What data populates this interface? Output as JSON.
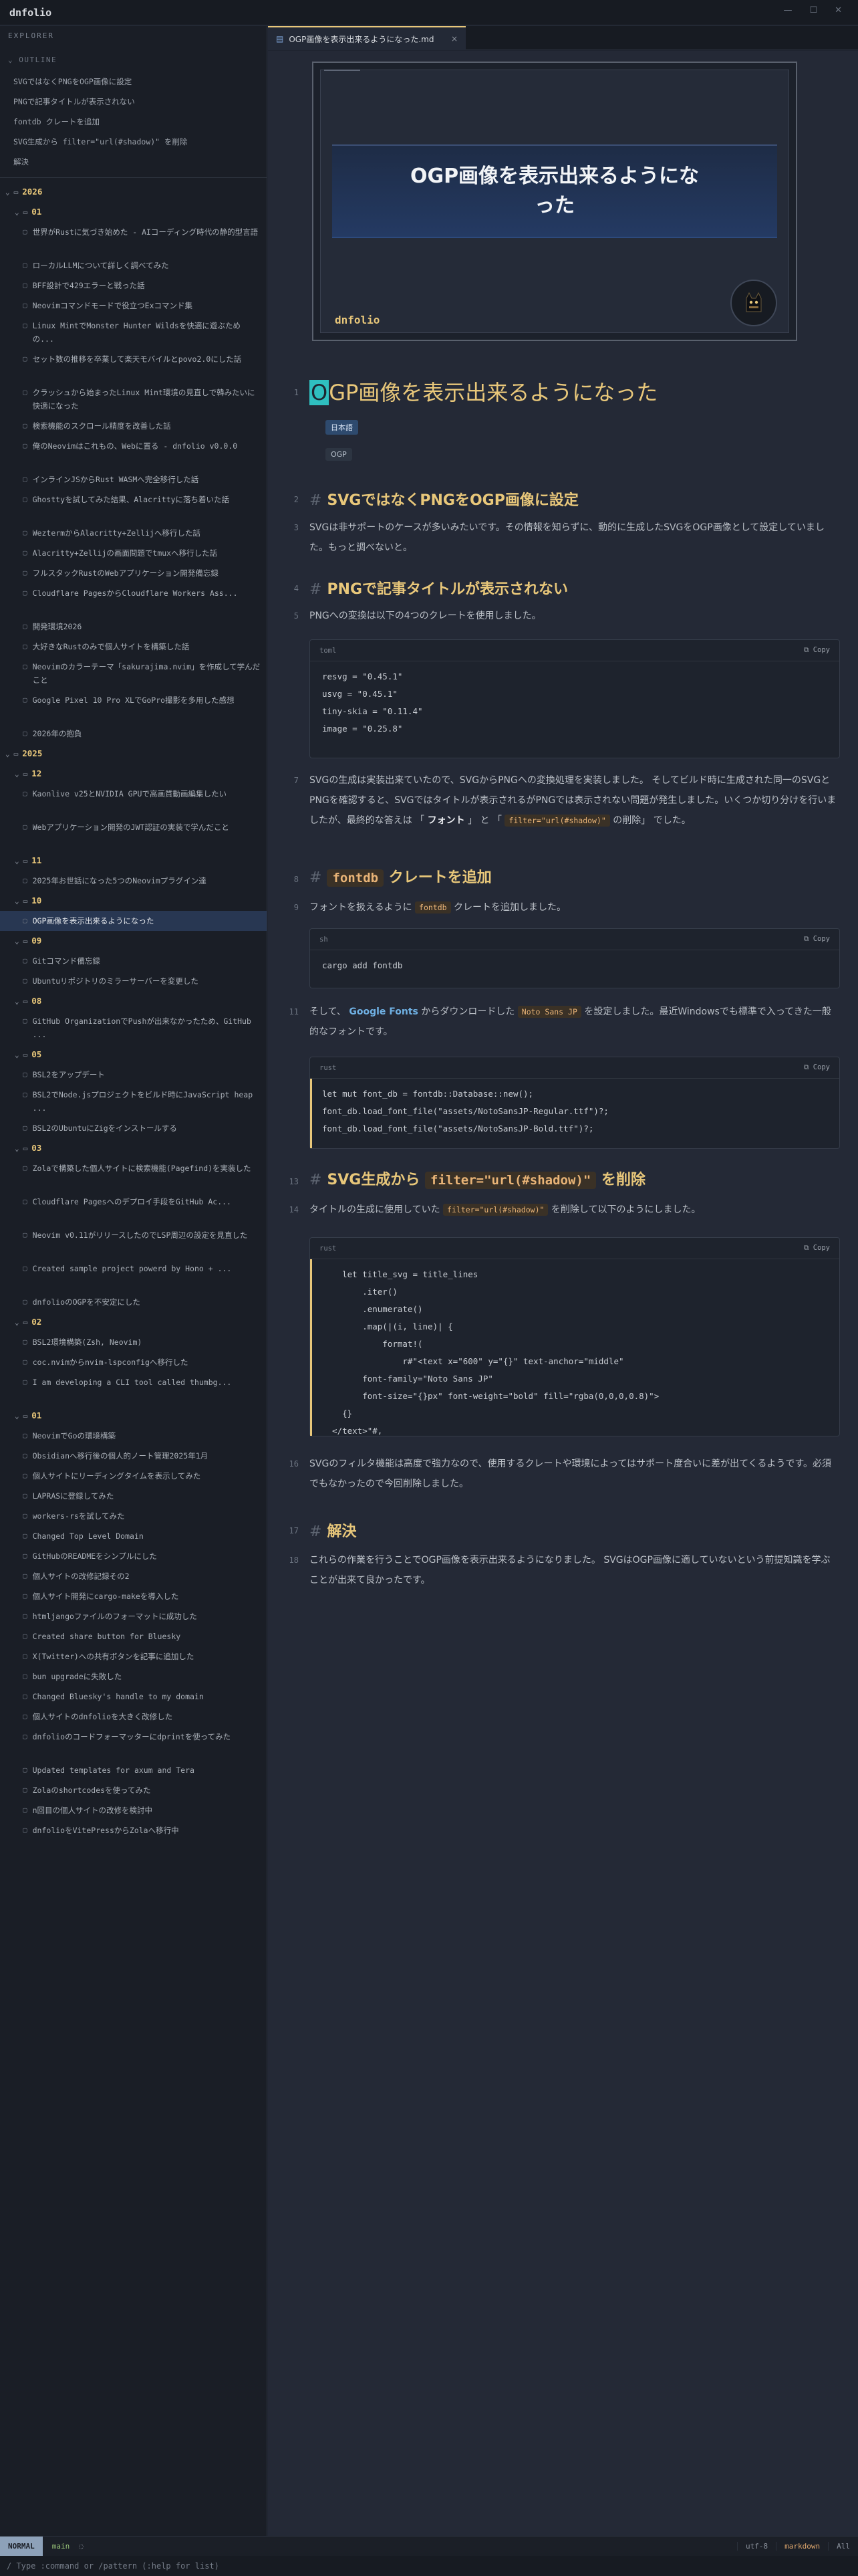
{
  "app": {
    "title": "dnfolio",
    "min": "—",
    "max": "☐",
    "close": "✕"
  },
  "sidebar": {
    "header": "EXPLORER",
    "outline_label": "⌄ OUTLINE",
    "outline": [
      "SVGではなくPNGをOGP画像に設定",
      "PNGで記事タイトルが表示されない",
      "fontdb クレートを追加",
      "SVG生成から filter=\"url(#shadow)\" を削除",
      "解決"
    ],
    "tree": [
      {
        "kind": "year",
        "label": "2026"
      },
      {
        "kind": "month",
        "label": "01"
      },
      {
        "kind": "file",
        "label": "世界がRustに気づき始めた - AIコーディング時代の静的型言語",
        "two": true
      },
      {
        "kind": "file",
        "label": "ローカルLLMについて詳しく調べてみた"
      },
      {
        "kind": "file",
        "label": "BFF設計で429エラーと戦った話"
      },
      {
        "kind": "file",
        "label": "Neovimコマンドモードで役立つExコマンド集"
      },
      {
        "kind": "file",
        "label": "Linux MintでMonster Hunter Wildsを快適に遊ぶための...",
        "two": true
      },
      {
        "kind": "file",
        "label": "セット数の推移を卒業して楽天モバイルとpovo2.0にした話",
        "two": true
      },
      {
        "kind": "file",
        "label": "クラッシュから始まったLinux Mint環境の見直しで韓みたいに快適になった",
        "two": true
      },
      {
        "kind": "file",
        "label": "検索機能のスクロール精度を改善した話"
      },
      {
        "kind": "file",
        "label": "俺のNeovimはこれもの、Webに置る - dnfolio v0.0.0",
        "two": true
      },
      {
        "kind": "file",
        "label": "インラインJSからRust WASMへ完全移行した話"
      },
      {
        "kind": "file",
        "label": "Ghosttyを試してみた結果、Alacrittyに落ち着いた話",
        "two": true
      },
      {
        "kind": "file",
        "label": "WeztermからAlacritty+Zellijへ移行した話"
      },
      {
        "kind": "file",
        "label": "Alacritty+Zellijの画面問題でtmuxへ移行した話"
      },
      {
        "kind": "file",
        "label": "フルスタックRustのWebアプリケーション開発備忘録"
      },
      {
        "kind": "file",
        "label": "Cloudflare PagesからCloudflare Workers Ass...",
        "two": true
      },
      {
        "kind": "file",
        "label": "開発環境2026"
      },
      {
        "kind": "file",
        "label": "大好きなRustのみで個人サイトを構築した話"
      },
      {
        "kind": "file",
        "label": "Neovimのカラーテーマ「sakurajima.nvim」を作成して学んだこと",
        "two": true
      },
      {
        "kind": "file",
        "label": "Google Pixel 10 Pro XLでGoPro撮影を多用した感想",
        "two": true
      },
      {
        "kind": "file",
        "label": "2026年の抱負"
      },
      {
        "kind": "year",
        "label": "2025"
      },
      {
        "kind": "month",
        "label": "12"
      },
      {
        "kind": "file",
        "label": "Kaonlive v25とNVIDIA GPUで高画質動画編集したい",
        "two": true
      },
      {
        "kind": "file",
        "label": "Webアプリケーション開発のJWT認証の実装で学んだこと",
        "two": true
      },
      {
        "kind": "month",
        "label": "11"
      },
      {
        "kind": "file",
        "label": "2025年お世話になった5つのNeovimプラグイン達"
      },
      {
        "kind": "month",
        "label": "10"
      },
      {
        "kind": "file",
        "label": "OGP画像を表示出来るようになった",
        "active": true
      },
      {
        "kind": "month",
        "label": "09"
      },
      {
        "kind": "file",
        "label": "Gitコマンド備忘録"
      },
      {
        "kind": "file",
        "label": "Ubuntuリポジトリのミラーサーバーを変更した"
      },
      {
        "kind": "month",
        "label": "08"
      },
      {
        "kind": "file",
        "label": "GitHub OrganizationでPushが出来なかったため、GitHub ...",
        "two": true
      },
      {
        "kind": "month",
        "label": "05"
      },
      {
        "kind": "file",
        "label": "BSL2をアップデート"
      },
      {
        "kind": "file",
        "label": "BSL2でNode.jsプロジェクトをビルド時にJavaScript heap ...",
        "two": true
      },
      {
        "kind": "file",
        "label": "BSL2のUbuntuにZigをインストールする"
      },
      {
        "kind": "month",
        "label": "03"
      },
      {
        "kind": "file",
        "label": "Zolaで構築した個人サイトに検索機能(Pagefind)を実装した",
        "two": true
      },
      {
        "kind": "file",
        "label": "Cloudflare Pagesへのデプロイ手段をGitHub Ac...",
        "two": true
      },
      {
        "kind": "file",
        "label": "Neovim v0.11がリリースしたのでLSP周辺の設定を見直した",
        "two": true
      },
      {
        "kind": "file",
        "label": "Created sample project powerd by Hono + ...",
        "two": true
      },
      {
        "kind": "file",
        "label": "dnfolioのOGPを不安定にした"
      },
      {
        "kind": "month",
        "label": "02"
      },
      {
        "kind": "file",
        "label": "BSL2環境構築(Zsh, Neovim)"
      },
      {
        "kind": "file",
        "label": "coc.nvimからnvim-lspconfigへ移行した"
      },
      {
        "kind": "file",
        "label": "I am developing a CLI tool called thumbg...",
        "two": true
      },
      {
        "kind": "month",
        "label": "01"
      },
      {
        "kind": "file",
        "label": "NeovimでGoの環境構築"
      },
      {
        "kind": "file",
        "label": "Obsidianへ移行後の個人的ノート管理2025年1月"
      },
      {
        "kind": "file",
        "label": "個人サイトにリーディングタイムを表示してみた"
      },
      {
        "kind": "file",
        "label": "LAPRASに登録してみた"
      },
      {
        "kind": "file",
        "label": "workers-rsを試してみた"
      },
      {
        "kind": "file",
        "label": "Changed Top Level Domain"
      },
      {
        "kind": "file",
        "label": "GitHubのREADMEをシンプルにした"
      },
      {
        "kind": "file",
        "label": "個人サイトの改修記録その2"
      },
      {
        "kind": "file",
        "label": "個人サイト開発にcargo-makeを導入した"
      },
      {
        "kind": "file",
        "label": "htmljangoファイルのフォーマットに成功した"
      },
      {
        "kind": "file",
        "label": "Created share button for Bluesky"
      },
      {
        "kind": "file",
        "label": "X(Twitter)への共有ボタンを記事に追加した"
      },
      {
        "kind": "file",
        "label": "bun upgradeに失敗した"
      },
      {
        "kind": "file",
        "label": "Changed Bluesky's handle to my domain"
      },
      {
        "kind": "file",
        "label": "個人サイトのdnfolioを大きく改修した"
      },
      {
        "kind": "file",
        "label": "dnfolioのコードフォーマッターにdprintを使ってみた",
        "two": true
      },
      {
        "kind": "file",
        "label": "Updated templates for axum and Tera"
      },
      {
        "kind": "file",
        "label": "Zolaのshortcodesを使ってみた"
      },
      {
        "kind": "file",
        "label": "n回目の個人サイトの改修を検討中"
      },
      {
        "kind": "file",
        "label": "dnfolioをVitePressからZolaへ移行中"
      }
    ]
  },
  "tab": {
    "label": "OGP画像を表示出来るようになった.md",
    "close": "×"
  },
  "ogp": {
    "title": "OGP画像を表示出来るようにな\nった",
    "brand": "dnfolio"
  },
  "doc": {
    "h1_first": "O",
    "h1_rest": "GP画像を表示出来るようになった",
    "tags": [
      "日本語",
      "OGP"
    ],
    "h2_1": "SVGではなくPNGをOGP画像に設定",
    "p_1": "SVGは非サポートのケースが多いみたいです。その情報を知らずに、動的に生成したSVGをOGP画像として設定していました。もっと調べないと。",
    "h2_2": "PNGで記事タイトルが表示されない",
    "p_2": "PNGへの変換は以下の4つのクレートを使用しました。",
    "code_1": {
      "lang": "toml",
      "copy": "Copy",
      "body": "resvg = \"0.45.1\"\nusvg = \"0.45.1\"\ntiny-skia = \"0.11.4\"\nimage = \"0.25.8\""
    },
    "p_3a": "SVGの生成は実装出来ていたので、SVGからPNGへの変換処理を実装しました。 そしてビルド時に生成された同一のSVGとPNGを確認すると、SVGではタイトルが表示されるがPNGでは表示されない問題が発生しました。いくつか切り分けを行いましたが、最終的な答えは 「",
    "p_3_font": "フォント",
    "p_3b": "」 と 「",
    "p_3_code": "filter=\"url(#shadow)\"",
    "p_3c": "の削除」 でした。",
    "h2_3_code": "fontdb",
    "h2_3_text": "クレートを追加",
    "p_4a": "フォントを扱えるように",
    "p_4_code": "fontdb",
    "p_4b": "クレートを追加しました。",
    "code_2": {
      "lang": "sh",
      "copy": "Copy",
      "body": "cargo add fontdb"
    },
    "p_5a": "そして、",
    "p_5_link": "Google Fonts",
    "p_5b": "からダウンロードした",
    "p_5_code": "Noto Sans JP",
    "p_5c": "を設定しました。最近Windowsでも標準で入ってきた一般的なフォントです。",
    "code_3": {
      "lang": "rust",
      "copy": "Copy",
      "body": "let mut font_db = fontdb::Database::new();\nfont_db.load_font_file(\"assets/NotoSansJP-Regular.ttf\")?;\nfont_db.load_font_file(\"assets/NotoSansJP-Bold.ttf\")?;"
    },
    "h2_4a": "SVG生成から",
    "h2_4_code": "filter=\"url(#shadow)\"",
    "h2_4b": "を削除",
    "p_6a": "タイトルの生成に使用していた",
    "p_6_code": "filter=\"url(#shadow)\"",
    "p_6b": "を削除して以下のようにしました。",
    "code_4": {
      "lang": "rust",
      "copy": "Copy",
      "body": "    let title_svg = title_lines\n        .iter()\n        .enumerate()\n        .map(|(i, line)| {\n            format!(\n                r#\"<text x=\"600\" y=\"{}\" text-anchor=\"middle\"\n        font-family=\"Noto Sans JP\"\n        font-size=\"{}px\" font-weight=\"bold\" fill=\"rgba(0,0,0,0.8)\">\n    {}\n  </text>\"#,"
    },
    "p_7": "SVGのフィルタ機能は高度で強力なので、使用するクレートや環境によってはサポート度合いに差が出てくるようです。必須でもなかったので今回削除しました。",
    "h2_5": "解決",
    "p_8": "これらの作業を行うことでOGP画像を表示出来るようになりました。 SVGはOGP画像に適していないという前提知識を学ぶことが出来て良かったです。",
    "line_numbers": [
      "1",
      "2",
      "3",
      "4",
      "5",
      "7",
      "8",
      "9",
      "11",
      "13",
      "14",
      "16",
      "17",
      "18"
    ]
  },
  "status": {
    "mode": "NORMAL",
    "branch": "main",
    "encoding": "utf-8",
    "filetype": "markdown",
    "position": "All"
  },
  "cmdline": "/ Type :command or /pattern (:help for list)",
  "colors": {
    "accent": "#e8c77a",
    "background": "#242936",
    "sidebar": "#1a1e26",
    "code_inline": "#e9b477",
    "link": "#6fb0e3"
  }
}
